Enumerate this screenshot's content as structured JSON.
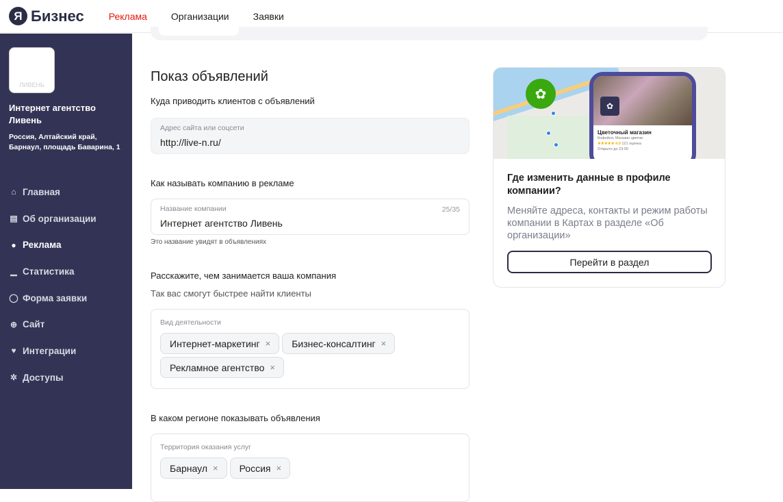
{
  "header": {
    "logo_mark": "Я",
    "logo_text": "Бизнес",
    "nav": [
      "Реклама",
      "Организации",
      "Заявки"
    ]
  },
  "sidebar": {
    "logo_text": "ЛИВЕНЬ",
    "org_name": "Интернет агентство Ливень",
    "address": "Россия, Алтайский край, Барнаул, площадь Баварина, 1",
    "items": [
      {
        "label": "Главная",
        "icon": "⌂"
      },
      {
        "label": "Об организации",
        "icon": "▤"
      },
      {
        "label": "Реклама",
        "icon": "●"
      },
      {
        "label": "Статистика",
        "icon": "▁"
      },
      {
        "label": "Форма заявки",
        "icon": "◯"
      },
      {
        "label": "Сайт",
        "icon": "⊕"
      },
      {
        "label": "Интеграции",
        "icon": "♥"
      },
      {
        "label": "Доступы",
        "icon": "✲"
      }
    ]
  },
  "main": {
    "title": "Показ объявлений",
    "site_section": "Куда приводить клиентов с объявлений",
    "site_label": "Адрес сайта или соцсети",
    "site_value": "http://live-n.ru/",
    "name_section": "Как называть компанию в рекламе",
    "name_label": "Название компании",
    "name_value": "Интернет агентство Ливень",
    "name_count": "25/35",
    "name_hint": "Это название увидят в объявлениях",
    "activity_section": "Расскажите, чем занимается ваша компания",
    "activity_sub": "Так вас смогут быстрее найти клиенты",
    "activity_label": "Вид деятельности",
    "activities": [
      "Интернет-маркетинг",
      "Бизнес-консалтинг",
      "Рекламное агентство"
    ],
    "region_section": "В каком регионе показывать объявления",
    "region_label": "Территория оказания услуг",
    "regions": [
      "Барнаул",
      "Россия"
    ],
    "remove_icon": "×"
  },
  "card": {
    "preview_title": "Цветочный магазин",
    "preview_sub": "Кофейня, Магазин цветов",
    "preview_rating": "★★★★★ 4.9",
    "preview_reviews": "121 оценка",
    "preview_hours": "Открыто до 23:00",
    "title": "Где изменить данные в профиле компании?",
    "desc": "Меняйте адреса, контакты и режим работы компании в Картах в разделе «Об организации»",
    "button": "Перейти в раздел"
  }
}
